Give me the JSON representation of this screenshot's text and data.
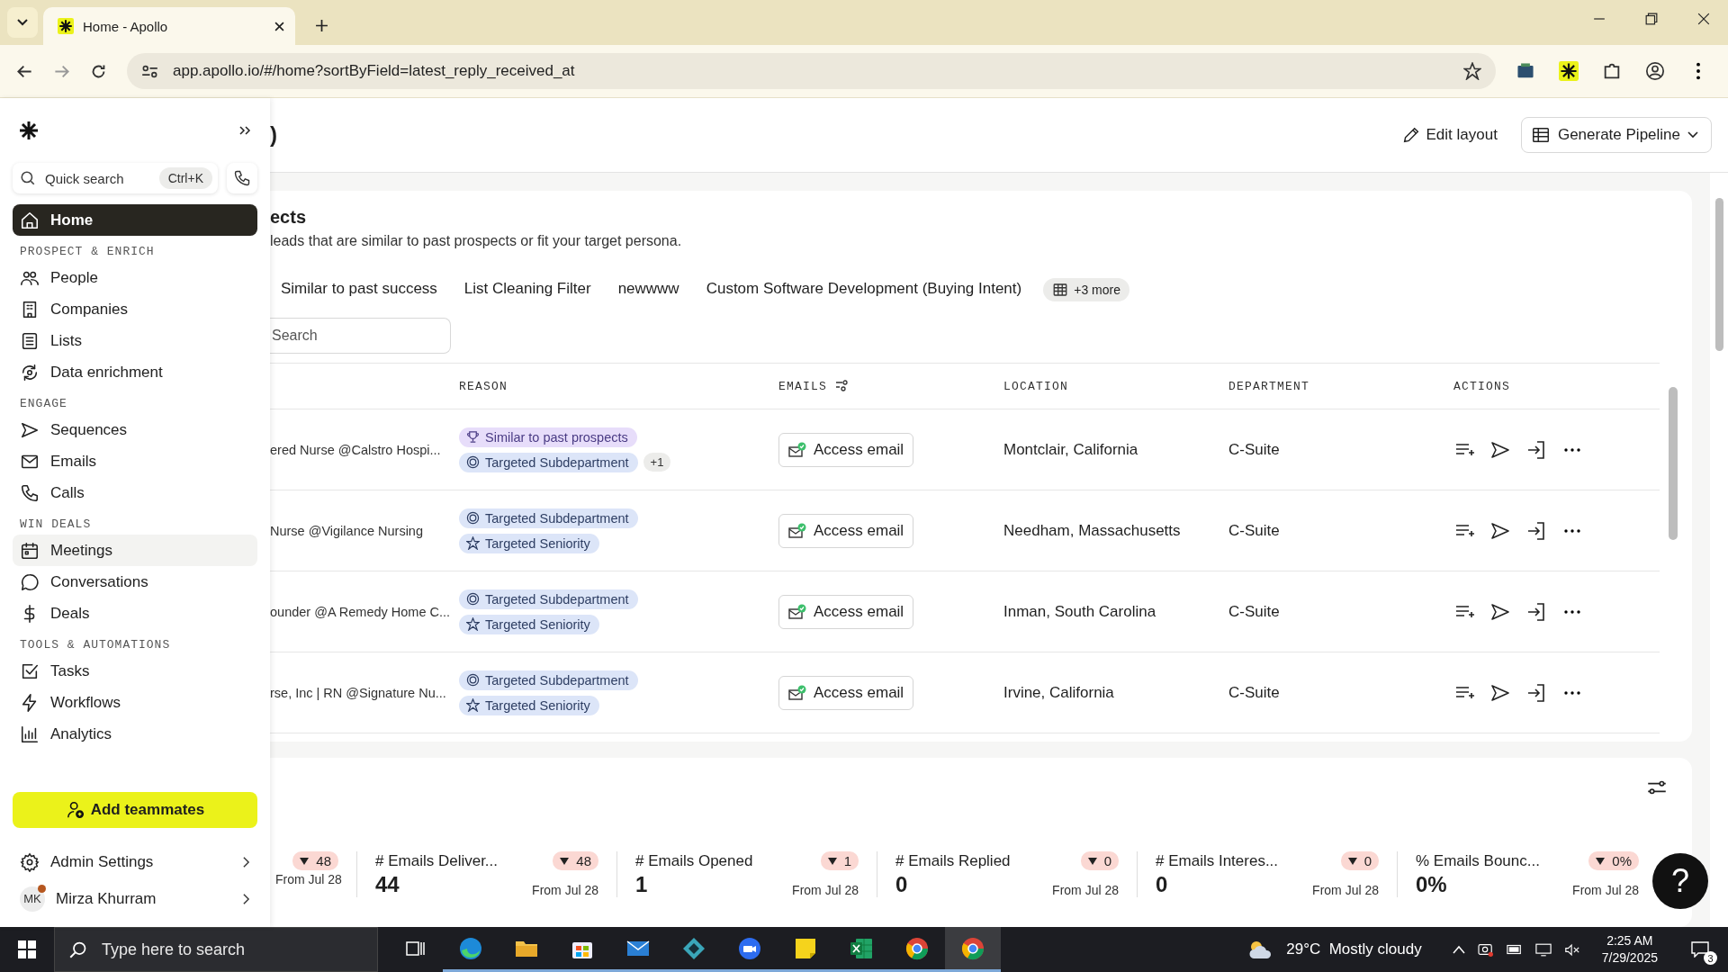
{
  "browser": {
    "tab_title": "Home - Apollo",
    "url": "app.apollo.io/#/home?sortByField=latest_reply_received_at"
  },
  "sidebar": {
    "search": {
      "placeholder": "Quick search",
      "shortcut": "Ctrl+K"
    },
    "groups": [
      {
        "items": [
          {
            "label": "Home",
            "selected": true,
            "hovered": false
          }
        ]
      },
      {
        "heading": "PROSPECT & ENRICH",
        "items": [
          {
            "label": "People",
            "selected": false,
            "hovered": false
          },
          {
            "label": "Companies",
            "selected": false,
            "hovered": false
          },
          {
            "label": "Lists",
            "selected": false,
            "hovered": false
          },
          {
            "label": "Data enrichment",
            "selected": false,
            "hovered": false
          }
        ]
      },
      {
        "heading": "ENGAGE",
        "items": [
          {
            "label": "Sequences",
            "selected": false,
            "hovered": false
          },
          {
            "label": "Emails",
            "selected": false,
            "hovered": false
          },
          {
            "label": "Calls",
            "selected": false,
            "hovered": false
          }
        ]
      },
      {
        "heading": "WIN DEALS",
        "items": [
          {
            "label": "Meetings",
            "selected": false,
            "hovered": true
          },
          {
            "label": "Conversations",
            "selected": false,
            "hovered": false
          },
          {
            "label": "Deals",
            "selected": false,
            "hovered": false
          }
        ]
      },
      {
        "heading": "TOOLS & AUTOMATIONS",
        "items": [
          {
            "label": "Tasks",
            "selected": false,
            "hovered": false
          },
          {
            "label": "Workflows",
            "selected": false,
            "hovered": false
          },
          {
            "label": "Analytics",
            "selected": false,
            "hovered": false
          }
        ]
      }
    ],
    "add_button": "Add teammates",
    "admin": "Admin Settings",
    "user": {
      "initials": "MK",
      "name": "Mirza Khurram",
      "notification": true
    }
  },
  "header": {
    "title_fragment": ")",
    "edit_layout": "Edit layout",
    "generate": "Generate Pipeline"
  },
  "prospects": {
    "title": "ects",
    "subtitle": "leads that are similar to past prospects or fit your target persona.",
    "tabs": [
      {
        "label": "Similar to past success",
        "selected": false
      },
      {
        "label": "List Cleaning Filter",
        "selected": false
      },
      {
        "label": "newwww",
        "selected": false
      },
      {
        "label": "Custom Software Development (Buying Intent)",
        "selected": false
      }
    ],
    "more": "+3 more",
    "search": {
      "placeholder": "Search"
    },
    "columns": [
      "REASON",
      "EMAILS",
      "LOCATION",
      "DEPARTMENT",
      "ACTIONS"
    ],
    "rows": [
      {
        "title": "ered Nurse @Calstro Hospi...",
        "reasons": [
          {
            "label": "Similar to past prospects",
            "kind": "trophy"
          },
          {
            "label": "Targeted Subdepartment",
            "kind": "target"
          }
        ],
        "extra": "+1",
        "email": "Access email",
        "location": "Montclair, California",
        "department": "C-Suite"
      },
      {
        "title": "Nurse @Vigilance Nursing",
        "reasons": [
          {
            "label": "Targeted Subdepartment",
            "kind": "target"
          },
          {
            "label": "Targeted Seniority",
            "kind": "star"
          }
        ],
        "email": "Access email",
        "location": "Needham, Massachusetts",
        "department": "C-Suite"
      },
      {
        "title": "ounder @A Remedy Home C...",
        "reasons": [
          {
            "label": "Targeted Subdepartment",
            "kind": "target"
          },
          {
            "label": "Targeted Seniority",
            "kind": "star"
          }
        ],
        "email": "Access email",
        "location": "Inman, South Carolina",
        "department": "C-Suite"
      },
      {
        "title": "rse, Inc | RN @Signature Nu...",
        "reasons": [
          {
            "label": "Targeted Subdepartment",
            "kind": "target"
          },
          {
            "label": "Targeted Seniority",
            "kind": "star"
          }
        ],
        "email": "Access email",
        "location": "Irvine, California",
        "department": "C-Suite"
      }
    ]
  },
  "stats": [
    {
      "change": "48",
      "since": "From Jul 28"
    },
    {
      "title": "# Emails Deliver...",
      "change": "48",
      "value": "44",
      "since": "From Jul 28"
    },
    {
      "title": "# Emails Opened",
      "change": "1",
      "value": "1",
      "since": "From Jul 28"
    },
    {
      "title": "# Emails Replied",
      "change": "0",
      "value": "0",
      "since": "From Jul 28"
    },
    {
      "title": "# Emails Interes...",
      "change": "0",
      "value": "0",
      "since": "From Jul 28"
    },
    {
      "title": "% Emails Bounc...",
      "change": "0%",
      "value": "0%",
      "since": "From Jul 28"
    }
  ],
  "help": "?",
  "taskbar": {
    "search_placeholder": "Type here to search",
    "weather": "29°C  Mostly cloudy",
    "time": "2:25 AM",
    "date": "7/29/2025",
    "notifications": "3"
  }
}
